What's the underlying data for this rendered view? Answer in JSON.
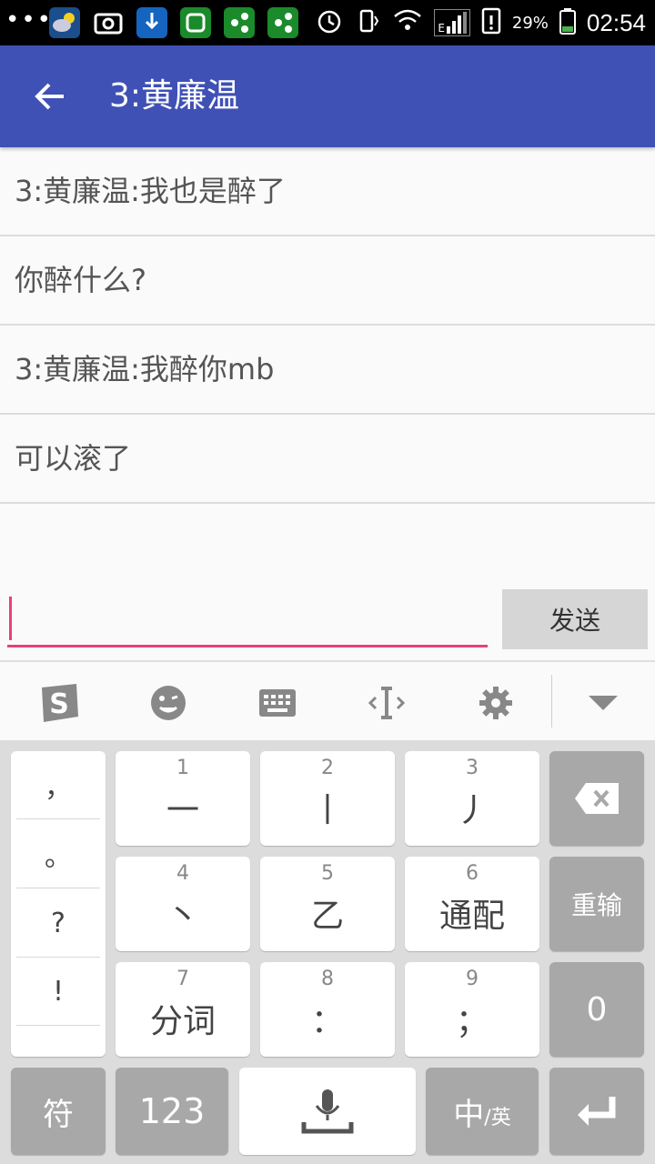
{
  "status_bar": {
    "time": "02:54",
    "battery_percent": "29%",
    "network_label": "E",
    "app_icons": [
      "weather-icon",
      "screenshot-icon",
      "download-icon",
      "green-app-icon",
      "share-app-icon",
      "share-app-icon-2"
    ]
  },
  "app_bar": {
    "title": "3:黄廉温"
  },
  "messages": [
    "3:黄廉温:我也是醉了",
    "你醉什么?",
    "3:黄廉温:我醉你mb",
    "可以滚了"
  ],
  "composer": {
    "send_label": "发送",
    "value": ""
  },
  "keyboard": {
    "punctuation": [
      "，",
      "。",
      "?",
      "!"
    ],
    "keys": [
      {
        "num": "1",
        "label": "一"
      },
      {
        "num": "2",
        "label": "丨"
      },
      {
        "num": "3",
        "label": "丿"
      },
      {
        "num": "4",
        "label": "丶"
      },
      {
        "num": "5",
        "label": "乙"
      },
      {
        "num": "6",
        "label": "通配"
      },
      {
        "num": "7",
        "label": "分词"
      },
      {
        "num": "8",
        "label": "："
      },
      {
        "num": "9",
        "label": "；"
      }
    ],
    "reinput_label": "重输",
    "zero_label": "0",
    "symbol_label": "符",
    "num_label": "123",
    "lang_main": "中",
    "lang_sub": "/英"
  },
  "colors": {
    "app_bar": "#3f51b5",
    "accent": "#e8407a"
  }
}
